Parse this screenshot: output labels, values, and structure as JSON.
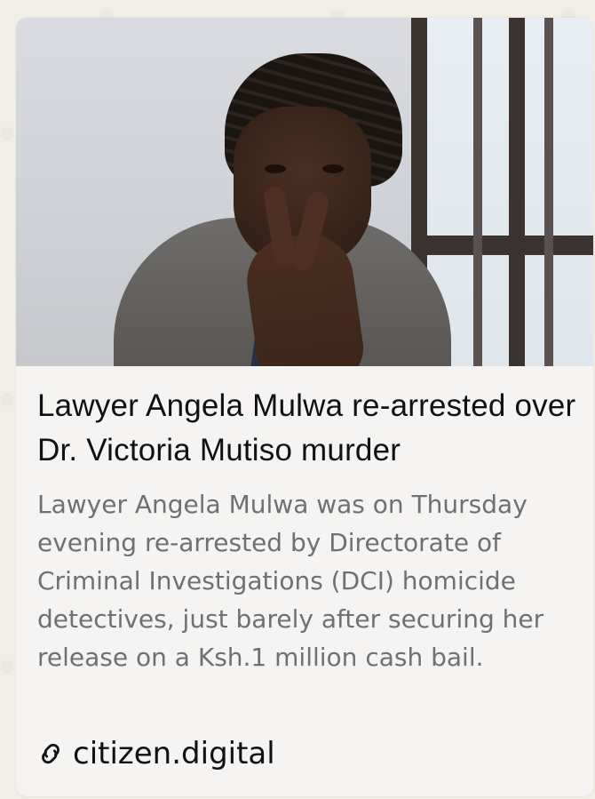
{
  "link_preview": {
    "title": "Lawyer Angela Mulwa re-arrested over Dr. Victoria Mutiso murder",
    "description": "Lawyer Angela Mulwa was on Thursday evening re-arrested by Directorate of Criminal Investigations (DCI) homicide detectives, just barely after securing her release on a Ksh.1 million cash bail.",
    "source_label": "citizen.digital",
    "source_icon": "link-icon",
    "thumbnail_icon": "news-photo"
  },
  "colors": {
    "card_background": "#f5f4f2",
    "title_color": "#111111",
    "description_color": "#707070",
    "chat_background": "#f1ede7"
  }
}
